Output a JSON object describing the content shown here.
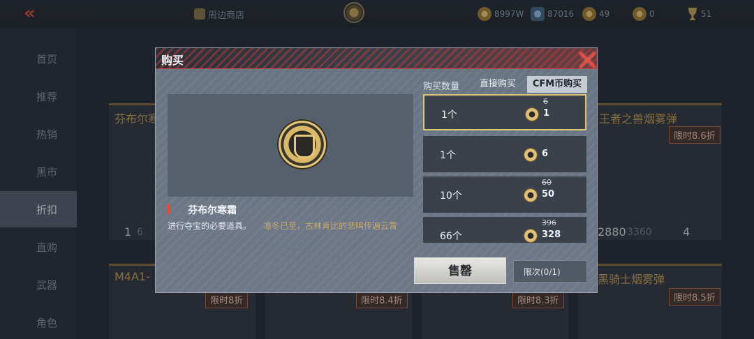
{
  "topbar": {
    "shop_link": "周边商店",
    "currencies": [
      {
        "icon": "gold-coin-icon",
        "value": "8997W"
      },
      {
        "icon": "blue-gem-icon",
        "value": "87016"
      },
      {
        "icon": "cfm-coin-icon",
        "value": "49"
      },
      {
        "icon": "token-icon",
        "value": "0"
      },
      {
        "icon": "trophy-icon",
        "value": "51"
      }
    ]
  },
  "sidebar": {
    "items": [
      {
        "label": "首页"
      },
      {
        "label": "推荐"
      },
      {
        "label": "热销"
      },
      {
        "label": "黑市"
      },
      {
        "label": "折扣"
      },
      {
        "label": "直购"
      },
      {
        "label": "武器"
      },
      {
        "label": "角色"
      }
    ],
    "active_index": 4
  },
  "background_cards": {
    "card1_title": "芬布尔寒",
    "card1_price": "1",
    "card1_old": "6",
    "card2_title": "王者之兽烟雾弹",
    "card2_tag": "限时8.6折",
    "card2_price": "2880",
    "card2_old": "3360",
    "card2_trophy": "4",
    "card3_title": "M4A1-",
    "card3_tag": "限时8折",
    "card4_tag": "限时8.4折",
    "card5_tag": "限时8.3折",
    "card6_title": "黑骑士烟雾弹",
    "card6_tag": "限时8.5折"
  },
  "modal": {
    "title": "购买",
    "quantity_label": "购买数量",
    "tabs": [
      {
        "label": "直接购买",
        "selected": false
      },
      {
        "label": "CFM币购买",
        "selected": true
      }
    ],
    "item": {
      "name": "芬布尔寒霜",
      "desc_main": "进行夺宝的必要道具。",
      "desc_flavor": "凛冬已至，古林肯比的悲鸣传遍云霄"
    },
    "options": [
      {
        "qty": "1个",
        "price": "1",
        "old_price": "6",
        "selected": true
      },
      {
        "qty": "1个",
        "price": "6",
        "old_price": "",
        "selected": false
      },
      {
        "qty": "10个",
        "price": "50",
        "old_price": "60",
        "selected": false
      },
      {
        "qty": "66个",
        "price": "328",
        "old_price": "396",
        "selected": false
      }
    ],
    "sell_button": "售罄",
    "limit_button": "限次(0/1)"
  }
}
